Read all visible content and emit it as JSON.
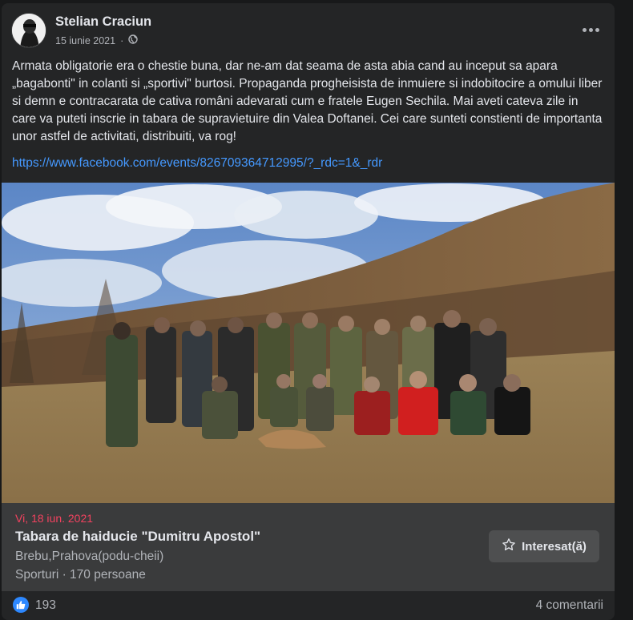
{
  "post": {
    "author": "Stelian Craciun",
    "date": "15 iunie 2021",
    "audience_icon": "globe-icon",
    "more_icon": "more-options-icon",
    "text": "Armata obligatorie era o chestie buna, dar ne-am dat seama de asta abia cand au inceput sa apara „bagabonti\" in colanti si „sportivi\" burtosi. Propaganda progheisista de inmuiere si indobitocire a omului liber si demn e contracarata de cativa români adevarati cum e fratele Eugen Sechila. Mai aveti cateva zile in care va puteti inscrie in tabara de supravietuire din Valea Doftanei. Cei care sunteti constienti de importanta unor astfel de activitati, distribuiti, va rog!",
    "link": "https://www.facebook.com/events/826709364712995/?_rdc=1&_rdr"
  },
  "event": {
    "date": "Vi, 18 iun. 2021",
    "title": "Tabara de haiducie \"Dumitru Apostol\"",
    "location": "Brebu,Prahova(podu-cheii)",
    "category": "Sporturi · 170 persoane",
    "interest_label": "Interesat(ă)",
    "interest_icon": "star-icon"
  },
  "reactions": {
    "like_icon": "like-icon",
    "like_count": "193",
    "comments": "4 comentarii"
  },
  "colors": {
    "background": "#18191a",
    "card": "#242526",
    "link": "#4599ff",
    "event_date": "#f3425f",
    "like": "#2d88ff"
  }
}
